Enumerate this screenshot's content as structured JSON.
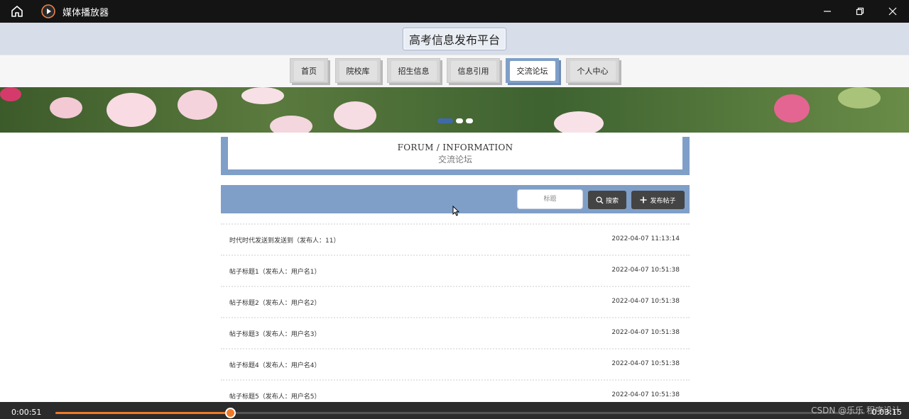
{
  "player": {
    "app_title": "媒体播放器",
    "controls": [
      "minimize-icon",
      "restore-icon",
      "close-icon"
    ],
    "current_time": "0:00:51",
    "total_time": "0:03:15",
    "progress": 0.2155,
    "watermark": "CSDN @乐乐 程序设计",
    "accent_color": "#f07a2a"
  },
  "site": {
    "title": "高考信息发布平台",
    "nav": [
      {
        "label": "首页",
        "active": false
      },
      {
        "label": "院校库",
        "active": false
      },
      {
        "label": "招生信息",
        "active": false
      },
      {
        "label": "信息引用",
        "active": false
      },
      {
        "label": "交流论坛",
        "active": true
      },
      {
        "label": "个人中心",
        "active": false
      }
    ],
    "accent_color": "#7f9fc8"
  },
  "banner": {
    "dots": [
      true,
      false,
      false
    ]
  },
  "forum": {
    "heading_en": "FORUM / INFORMATION",
    "heading_cn": "交流论坛",
    "search_placeholder": "标题",
    "search_label": "搜索",
    "post_label": "发布帖子",
    "posts": [
      {
        "title": "时代时代发送到发送到（发布人：11）",
        "time": "2022-04-07 11:13:14"
      },
      {
        "title": "帖子标题1（发布人：用户名1）",
        "time": "2022-04-07 10:51:38"
      },
      {
        "title": "帖子标题2（发布人：用户名2）",
        "time": "2022-04-07 10:51:38"
      },
      {
        "title": "帖子标题3（发布人：用户名3）",
        "time": "2022-04-07 10:51:38"
      },
      {
        "title": "帖子标题4（发布人：用户名4）",
        "time": "2022-04-07 10:51:38"
      },
      {
        "title": "帖子标题5（发布人：用户名5）",
        "time": "2022-04-07 10:51:38"
      }
    ]
  }
}
